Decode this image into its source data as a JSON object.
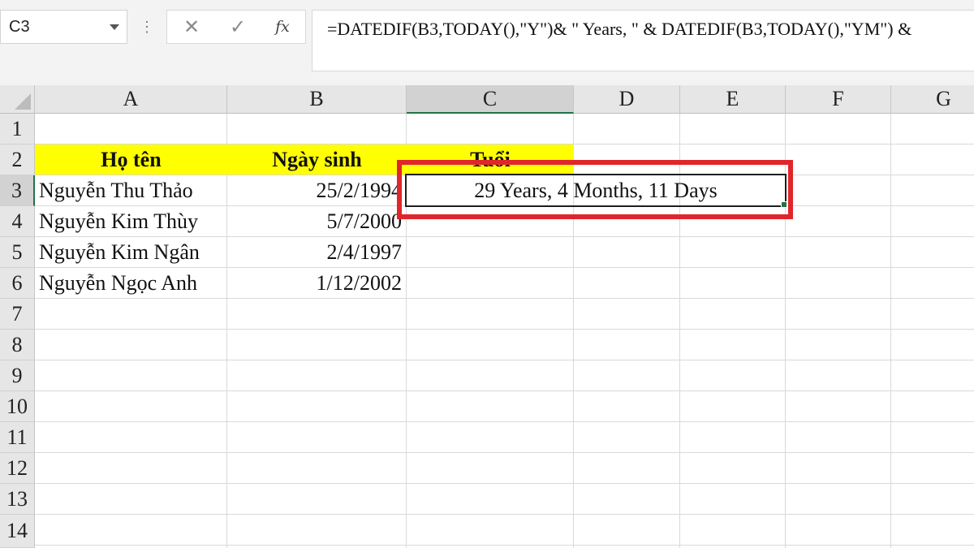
{
  "name_box": {
    "value": "C3"
  },
  "formula_bar": {
    "cancel_icon": "close-x-icon",
    "enter_icon": "checkmark-icon",
    "fx_label": "fx",
    "formula": "=DATEDIF(B3,TODAY(),\"Y\")& \" Years, \" & DATEDIF(B3,TODAY(),\"YM\") &"
  },
  "columns": [
    "A",
    "B",
    "C",
    "D",
    "E",
    "F",
    "G"
  ],
  "rows": [
    "1",
    "2",
    "3",
    "4",
    "5",
    "6",
    "7",
    "8",
    "9",
    "10",
    "11",
    "12",
    "13",
    "14"
  ],
  "selected_cell": "C3",
  "sheet": {
    "header_fill": "#ffff00",
    "headers": {
      "name": "Họ tên",
      "dob": "Ngày sinh",
      "age": "Tuổi"
    },
    "records": [
      {
        "name": "Nguyễn Thu Thảo",
        "dob": "25/2/1994",
        "age": "29 Years, 4 Months, 11 Days"
      },
      {
        "name": "Nguyễn Kim Thùy",
        "dob": "5/7/2000",
        "age": ""
      },
      {
        "name": "Nguyễn Kim Ngân",
        "dob": "2/4/1997",
        "age": ""
      },
      {
        "name": "Nguyễn Ngọc Anh",
        "dob": "1/12/2002",
        "age": ""
      }
    ]
  },
  "colors": {
    "highlight_box": "#e0262b",
    "selection": "#217346"
  }
}
